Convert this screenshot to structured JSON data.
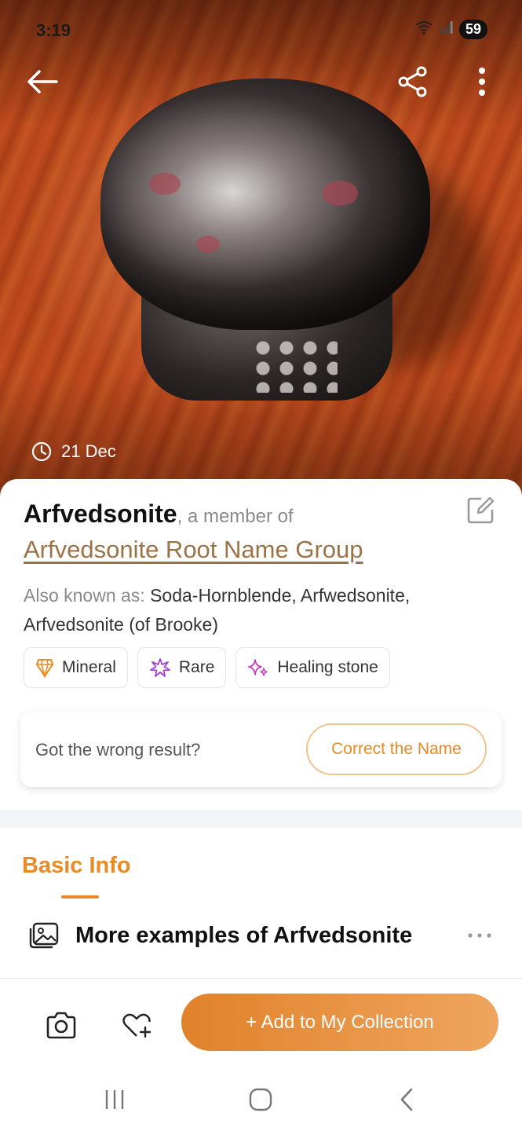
{
  "status_bar": {
    "time": "3:19",
    "battery": "59"
  },
  "hero": {
    "date": "21 Dec"
  },
  "result": {
    "name": "Arfvedsonite",
    "member_of": ", a member of",
    "group": "Arfvedsonite Root Name Group",
    "aka_label": "Also known as:",
    "aka_value": "Soda-Hornblende, Arfwedsonite, Arfvedsonite (of Brooke)"
  },
  "tags": [
    {
      "label": "Mineral",
      "icon": "gem-icon"
    },
    {
      "label": "Rare",
      "icon": "sparkle-burst-icon"
    },
    {
      "label": "Healing stone",
      "icon": "sparkles-icon"
    }
  ],
  "feedback": {
    "question": "Got the wrong result?",
    "button": "Correct the Name"
  },
  "tabs": {
    "basic_info": "Basic Info"
  },
  "examples": {
    "title": "More examples of Arfvedsonite"
  },
  "bottom": {
    "add_button": "+ Add to My Collection"
  },
  "colors": {
    "accent": "#e98a22",
    "link": "#9b7347"
  }
}
